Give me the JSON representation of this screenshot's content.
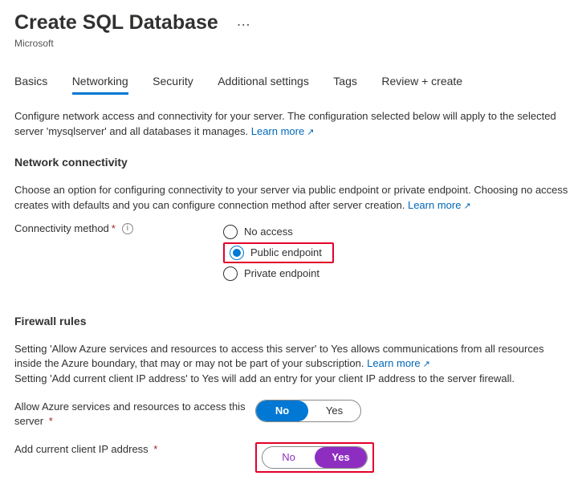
{
  "header": {
    "title": "Create SQL Database",
    "subtitle": "Microsoft",
    "more": "…"
  },
  "tabs": {
    "items": [
      "Basics",
      "Networking",
      "Security",
      "Additional settings",
      "Tags",
      "Review + create"
    ],
    "active_index": 1
  },
  "intro": {
    "text": "Configure network access and connectivity for your server. The configuration selected below will apply to the selected server 'mysqlserver' and all databases it manages.",
    "learn_more": "Learn more"
  },
  "network": {
    "heading": "Network connectivity",
    "desc": "Choose an option for configuring connectivity to your server via public endpoint or private endpoint. Choosing no access creates with defaults and you can configure connection method after server creation.",
    "learn_more": "Learn more",
    "field_label": "Connectivity method",
    "options": [
      "No access",
      "Public endpoint",
      "Private endpoint"
    ],
    "selected_index": 1
  },
  "firewall": {
    "heading": "Firewall rules",
    "desc1": "Setting 'Allow Azure services and resources to access this server' to Yes allows communications from all resources inside the Azure boundary, that may or may not be part of your subscription.",
    "learn_more": "Learn more",
    "desc2": "Setting 'Add current client IP address' to Yes will add an entry for your client IP address to the server firewall.",
    "allow_label": "Allow Azure services and resources to access this server",
    "allow_no": "No",
    "allow_yes": "Yes",
    "addip_label": "Add current client IP address",
    "addip_no": "No",
    "addip_yes": "Yes"
  }
}
